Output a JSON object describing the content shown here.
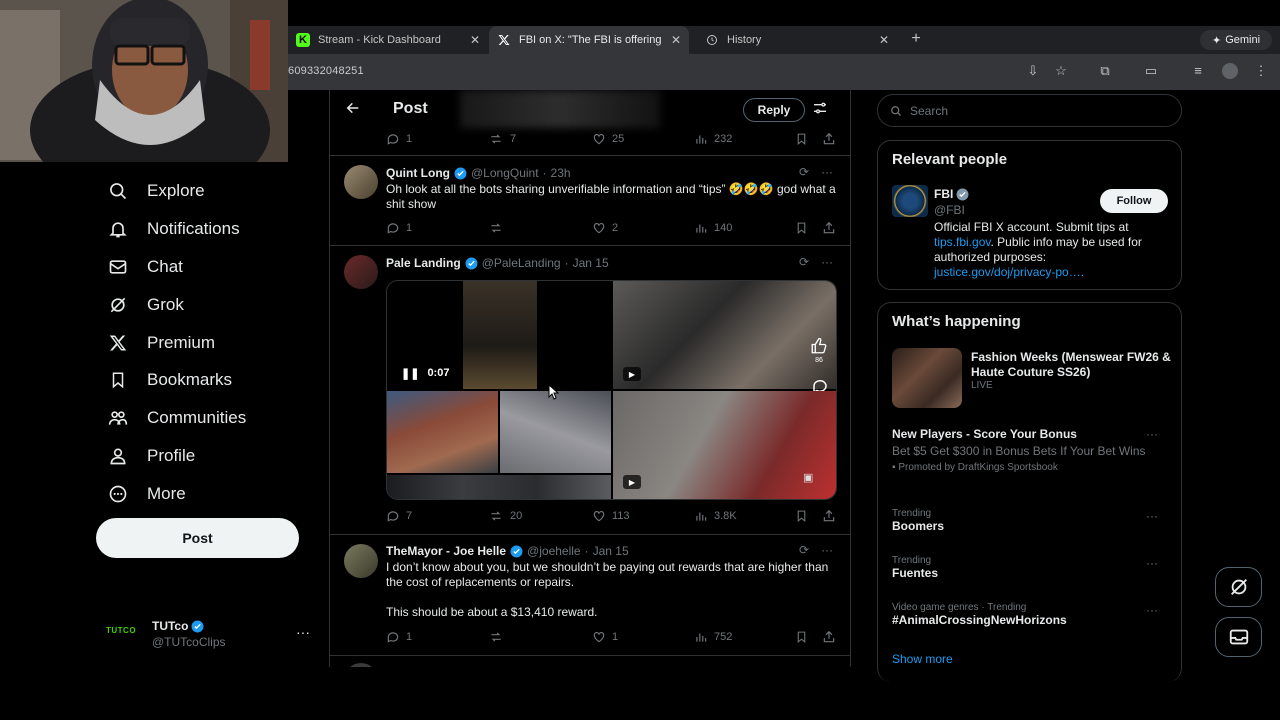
{
  "browser": {
    "tabs": [
      {
        "label": "Stream - Kick Dashboard",
        "favicon": "K"
      },
      {
        "label": "FBI on X: \"The FBI is offering",
        "favicon": "X"
      },
      {
        "label": "History",
        "favicon": "history-icon"
      }
    ],
    "url": "609332048251",
    "gemini_label": "Gemini"
  },
  "sidebar": {
    "items": [
      {
        "label": "Explore",
        "icon": "search-icon"
      },
      {
        "label": "Notifications",
        "icon": "bell-icon"
      },
      {
        "label": "Chat",
        "icon": "mail-icon"
      },
      {
        "label": "Grok",
        "icon": "grok-icon"
      },
      {
        "label": "Premium",
        "icon": "x-icon"
      },
      {
        "label": "Bookmarks",
        "icon": "bookmark-icon"
      },
      {
        "label": "Communities",
        "icon": "people-icon"
      },
      {
        "label": "Profile",
        "icon": "person-icon"
      },
      {
        "label": "More",
        "icon": "more-circle-icon"
      }
    ],
    "post_button": "Post",
    "account": {
      "logo": "TUTCO",
      "name": "TUTco",
      "handle": "@TUTcoClips",
      "more": "···"
    }
  },
  "main": {
    "title": "Post",
    "reply_button": "Reply",
    "top_actions": {
      "replies": "1",
      "reposts": "7",
      "likes": "25",
      "views": "232"
    },
    "tweets": [
      {
        "name": "Quint Long",
        "handle": "@LongQuint",
        "time": "23h",
        "text": "Oh look at all the bots sharing unverifiable information and “tips” 🤣🤣🤣 god what a shit show",
        "actions": {
          "replies": "1",
          "reposts": "",
          "likes": "2",
          "views": "140"
        }
      },
      {
        "name": "Pale Landing",
        "handle": "@PaleLanding",
        "time": "Jan 15",
        "text": "",
        "video_time": "0:07",
        "overlay_likes": "86",
        "actions": {
          "replies": "7",
          "reposts": "20",
          "likes": "113",
          "views": "3.8K"
        }
      },
      {
        "name": "TheMayor - Joe Helle",
        "handle": "@joehelle",
        "time": "Jan 15",
        "text": "I don’t know about you, but we shouldn’t be paying out rewards that are higher than the cost of replacements or repairs.",
        "text2": "This should be about a $13,410 reward.",
        "actions": {
          "replies": "1",
          "reposts": "",
          "likes": "1",
          "views": "752"
        }
      }
    ]
  },
  "right": {
    "search_placeholder": "Search",
    "relevant": {
      "title": "Relevant people",
      "name": "FBI",
      "handle": "@FBI",
      "follow": "Follow",
      "bio_1": "Official FBI X account. Submit tips at",
      "bio_link1": "tips.fbi.gov",
      "bio_2": ". Public info may be used for authorized purposes:",
      "bio_link2": "justice.gov/doj/privacy-po…."
    },
    "happening": {
      "title": "What’s happening",
      "featured": {
        "title": "Fashion Weeks (Menswear FW26 & Haute Couture SS26)",
        "status": "LIVE"
      },
      "promo": {
        "title": "New Players - Score Your Bonus",
        "desc": "Bet $5 Get $300 in Bonus Bets If Your Bet Wins",
        "promoted": "Promoted by DraftKings Sportsbook"
      },
      "trends": [
        {
          "context": "Trending",
          "name": "Boomers"
        },
        {
          "context": "Trending",
          "name": "Fuentes"
        },
        {
          "context": "Video game genres · Trending",
          "name": "#AnimalCrossingNewHorizons"
        }
      ],
      "show_more": "Show more"
    }
  }
}
